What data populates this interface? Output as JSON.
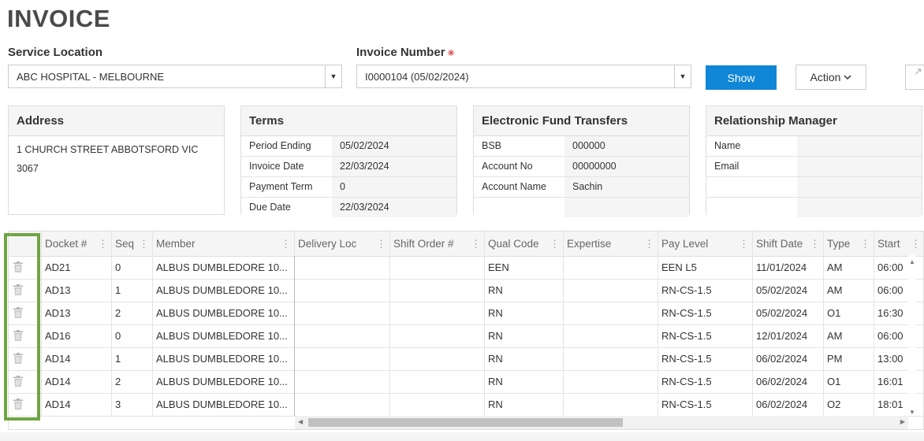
{
  "page": {
    "title": "INVOICE"
  },
  "filters": {
    "service_location_label": "Service Location",
    "service_location_value": "ABC HOSPITAL - MELBOURNE",
    "invoice_number_label": "Invoice Number",
    "required_mark": "✳",
    "invoice_number_value": "I0000104 (05/02/2024)",
    "show_label": "Show",
    "action_label": "Action",
    "action_chevron": "⌄",
    "export_glyph": "↗"
  },
  "address": {
    "heading": "Address",
    "text": "1 CHURCH STREET ABBOTSFORD VIC 3067"
  },
  "terms": {
    "heading": "Terms",
    "rows": [
      {
        "k": "Period Ending",
        "v": "05/02/2024"
      },
      {
        "k": "Invoice Date",
        "v": "22/03/2024"
      },
      {
        "k": "Payment Term",
        "v": "0"
      },
      {
        "k": "Due Date",
        "v": "22/03/2024"
      }
    ]
  },
  "eft": {
    "heading": "Electronic Fund Transfers",
    "rows": [
      {
        "k": "BSB",
        "v": "000000"
      },
      {
        "k": "Account No",
        "v": "00000000"
      },
      {
        "k": "Account Name",
        "v": "Sachin"
      },
      {
        "k": "",
        "v": ""
      }
    ]
  },
  "rm": {
    "heading": "Relationship Manager",
    "rows": [
      {
        "k": "Name",
        "v": ""
      },
      {
        "k": "Email",
        "v": ""
      },
      {
        "k": "",
        "v": ""
      },
      {
        "k": "",
        "v": ""
      }
    ]
  },
  "grid": {
    "columns": [
      "",
      "Docket #",
      "Seq",
      "Member",
      "Delivery Loc",
      "Shift Order #",
      "Qual Code",
      "Expertise",
      "Pay Level",
      "Shift Date",
      "Type",
      "Start"
    ],
    "rows": [
      [
        "AD21",
        "0",
        "ALBUS DUMBLEDORE 10...",
        "",
        "",
        "EEN",
        "",
        "EEN L5",
        "11/01/2024",
        "AM",
        "06:00"
      ],
      [
        "AD13",
        "1",
        "ALBUS DUMBLEDORE 10...",
        "",
        "",
        "RN",
        "",
        "RN-CS-1.5",
        "05/02/2024",
        "AM",
        "06:00"
      ],
      [
        "AD13",
        "2",
        "ALBUS DUMBLEDORE 10...",
        "",
        "",
        "RN",
        "",
        "RN-CS-1.5",
        "05/02/2024",
        "O1",
        "16:30"
      ],
      [
        "AD16",
        "0",
        "ALBUS DUMBLEDORE 10...",
        "",
        "",
        "RN",
        "",
        "RN-CS-1.5",
        "12/01/2024",
        "AM",
        "06:00"
      ],
      [
        "AD14",
        "1",
        "ALBUS DUMBLEDORE 10...",
        "",
        "",
        "RN",
        "",
        "RN-CS-1.5",
        "06/02/2024",
        "PM",
        "13:00"
      ],
      [
        "AD14",
        "2",
        "ALBUS DUMBLEDORE 10...",
        "",
        "",
        "RN",
        "",
        "RN-CS-1.5",
        "06/02/2024",
        "O1",
        "16:01"
      ],
      [
        "AD14",
        "3",
        "ALBUS DUMBLEDORE 10...",
        "",
        "",
        "RN",
        "",
        "RN-CS-1.5",
        "06/02/2024",
        "O2",
        "18:01"
      ]
    ]
  },
  "icons": {
    "row_action": "trash-icon",
    "column_menu": "kebab-icon"
  },
  "colors": {
    "primary": "#0f86d6",
    "highlight": "#70a544",
    "required": "#d9534f"
  }
}
